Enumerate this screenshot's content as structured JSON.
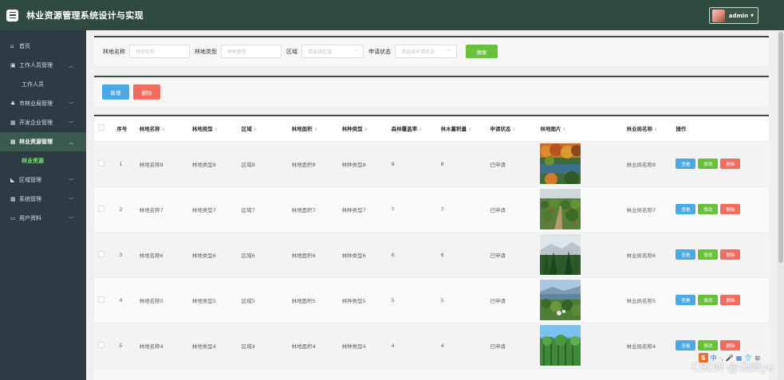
{
  "header": {
    "title": "林业资源管理系统设计与实现",
    "user": "admin"
  },
  "sidebar": {
    "items": [
      {
        "icon": "home-icon",
        "glyph": "⌂",
        "label": "首页",
        "chevron": ""
      },
      {
        "icon": "briefcase-icon",
        "glyph": "▣",
        "label": "工作人员管理",
        "chevron": "︿"
      },
      {
        "icon": "",
        "glyph": "",
        "label": "工作人员",
        "chevron": ""
      },
      {
        "icon": "tree-icon",
        "glyph": "♣",
        "label": "市林业局管理",
        "chevron": "﹀"
      },
      {
        "icon": "grid-icon",
        "glyph": "▦",
        "label": "开发企业管理",
        "chevron": "﹀"
      },
      {
        "icon": "grid-icon",
        "glyph": "▦",
        "label": "林业资源管理",
        "chevron": "︿"
      },
      {
        "icon": "",
        "glyph": "",
        "label": "林业资源",
        "chevron": ""
      },
      {
        "icon": "region-icon",
        "glyph": "◣",
        "label": "区域管理",
        "chevron": "﹀"
      },
      {
        "icon": "grid-icon",
        "glyph": "▦",
        "label": "系统管理",
        "chevron": "﹀"
      },
      {
        "icon": "profile-icon",
        "glyph": "▭",
        "label": "用户资料",
        "chevron": "﹀"
      }
    ]
  },
  "search": {
    "name_label": "林地名称",
    "name_placeholder": "林地名称",
    "type_label": "林地类型",
    "type_placeholder": "林地类型",
    "region_label": "区域",
    "region_placeholder": "请选择区域",
    "status_label": "申请状态",
    "status_placeholder": "请选择申请状态",
    "search_button": "搜索"
  },
  "actions": {
    "add_button": "新增",
    "delete_button": "删除"
  },
  "table": {
    "columns": [
      "序号",
      "林地名称",
      "林地类型",
      "区域",
      "林地面积",
      "林种类型",
      "森林覆盖率",
      "林木蓄积量",
      "申请状态",
      "林地图片",
      "林业局名称",
      "操作"
    ],
    "sort_glyph": "⇕",
    "rows": [
      {
        "index": "1",
        "name": "林地名称8",
        "type": "林地类型8",
        "region": "区域8",
        "area": "林地面积8",
        "species": "林种类型8",
        "coverage": "8",
        "volume": "8",
        "status": "已申请",
        "image": "autumn-lake-forest-photo",
        "bureau": "林业局名称8"
      },
      {
        "index": "2",
        "name": "林地名称7",
        "type": "林地类型7",
        "region": "区域7",
        "area": "林地面积7",
        "species": "林种类型7",
        "coverage": "7",
        "volume": "7",
        "status": "已申请",
        "image": "orchard-path-photo",
        "bureau": "林业局名称7"
      },
      {
        "index": "3",
        "name": "林地名称6",
        "type": "林地类型6",
        "region": "区域6",
        "area": "林地面积6",
        "species": "林种类型6",
        "coverage": "6",
        "volume": "6",
        "status": "已申请",
        "image": "pine-forest-photo",
        "bureau": "林业局名称6"
      },
      {
        "index": "4",
        "name": "林地名称5",
        "type": "林地类型5",
        "region": "区域5",
        "area": "林地面积5",
        "species": "林种类型5",
        "coverage": "5",
        "volume": "5",
        "status": "已申请",
        "image": "lakeside-forest-photo",
        "bureau": "林业局名称5"
      },
      {
        "index": "5",
        "name": "林地名称4",
        "type": "林地类型4",
        "region": "区域4",
        "area": "林地面积4",
        "species": "林种类型4",
        "coverage": "4",
        "volume": "4",
        "status": "已申请",
        "image": "green-woodland-photo",
        "bureau": "林业局名称4"
      }
    ],
    "ops": {
      "view": "查看",
      "edit": "修改",
      "delete": "删除"
    }
  },
  "overlay": {
    "watermark": "CSDN @汤姆yu",
    "ime_logo": "S",
    "ime_items": [
      "中",
      "·,",
      "🎤",
      "▦",
      "👕",
      "⊞"
    ]
  },
  "colors": {
    "topbar": "#2f4a3e",
    "sidebar": "#2e3b45",
    "active_group": "#3b5a4f",
    "active_sub_text": "#7ee07a",
    "btn_search": "#67c23a",
    "btn_add": "#4ba9e6",
    "btn_delete": "#f36c60"
  }
}
